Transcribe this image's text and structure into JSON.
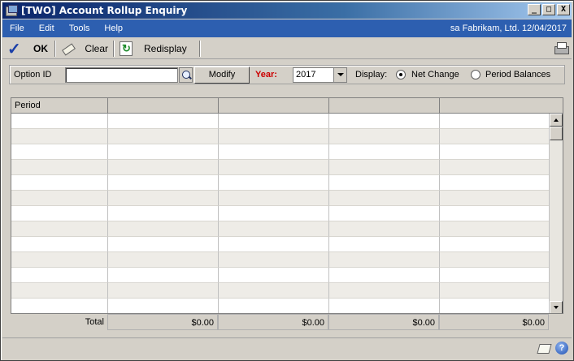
{
  "window": {
    "title": "[TWO] Account Rollup Enquiry"
  },
  "title_buttons": {
    "minimize": "_",
    "maximize": "□",
    "close": "X"
  },
  "menu": {
    "items": [
      "File",
      "Edit",
      "Tools",
      "Help"
    ],
    "user": "sa  Fabrikam, Ltd.  12/04/2017"
  },
  "toolbar": {
    "ok_label": "OK",
    "clear_label": "Clear",
    "redisplay_label": "Redisplay"
  },
  "filters": {
    "option_id_label": "Option ID",
    "option_id_value": "",
    "modify_label": "Modify",
    "year_label": "Year:",
    "year_value": "2017",
    "display_label": "Display:",
    "net_change_label": "Net Change",
    "period_balances_label": "Period Balances",
    "selected_display": "Net Change"
  },
  "grid": {
    "columns": [
      "Period",
      "",
      "",
      "",
      ""
    ],
    "row_count": 13
  },
  "totals": {
    "label": "Total",
    "values": [
      "$0.00",
      "$0.00",
      "$0.00",
      "$0.00"
    ]
  },
  "footer": {
    "help_glyph": "?"
  },
  "colors": {
    "menubar": "#2d5fb0",
    "year_label": "#cc0000",
    "check": "#1a3fa8"
  }
}
